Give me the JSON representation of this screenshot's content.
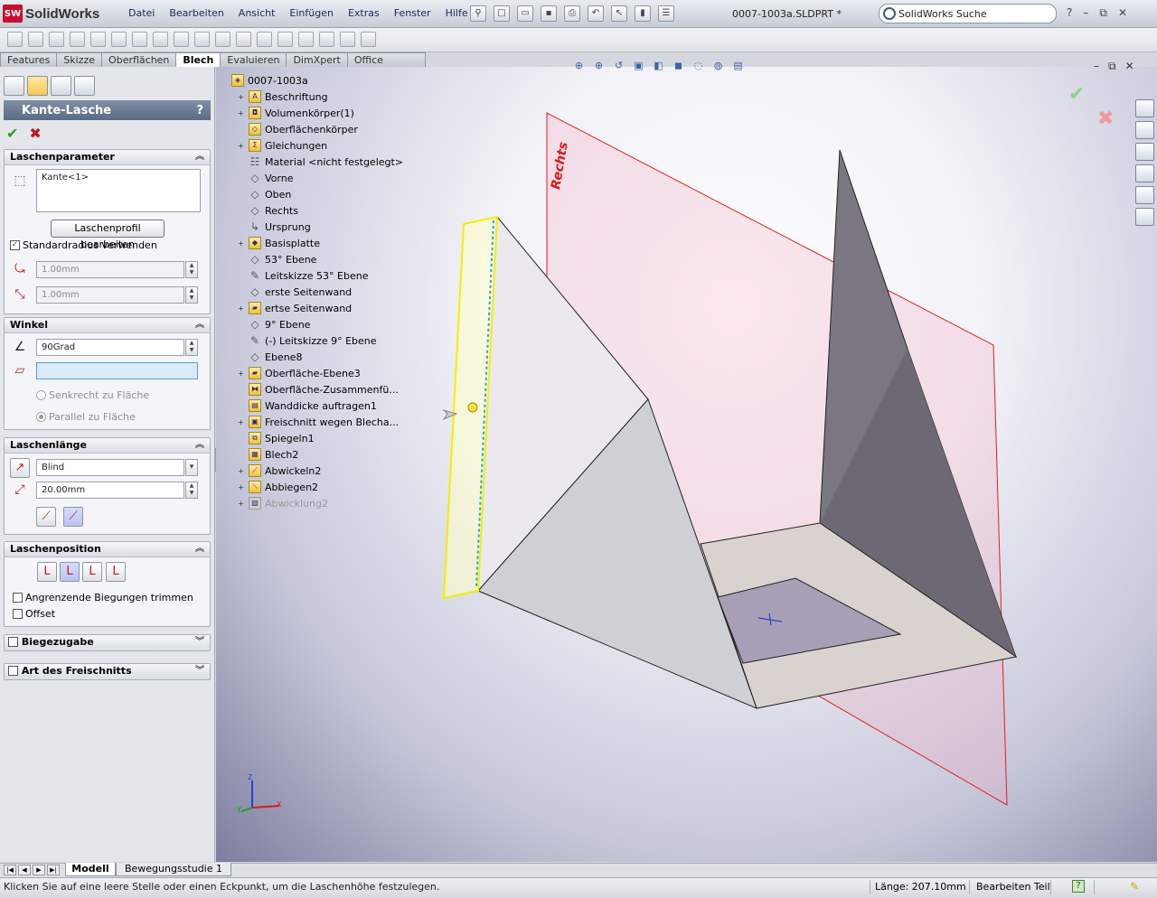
{
  "app": {
    "logo_badge": "SW",
    "logo_text": "SolidWorks",
    "document_title": "0007-1003a.SLDPRT *"
  },
  "menu": [
    "Datei",
    "Bearbeiten",
    "Ansicht",
    "Einfügen",
    "Extras",
    "Fenster",
    "Hilfe"
  ],
  "search": {
    "placeholder": "SolidWorks Suche"
  },
  "window_controls": {
    "help": "?",
    "minimize": "–",
    "restore": "⧉",
    "close": "✕"
  },
  "command_tabs": [
    "Features",
    "Skizze",
    "Oberflächen",
    "Blech",
    "Evaluieren",
    "DimXpert",
    "Office Produkte"
  ],
  "active_tab": "Blech",
  "property_manager": {
    "title": "Kante-Lasche",
    "help": "?",
    "ok": "✔",
    "cancel": "✖",
    "laschenparameter": {
      "header": "Laschenparameter",
      "edge_list": "Kante<1>",
      "edit_profile_button": "Laschenprofil bearbeiten",
      "use_default_radius": "Standardradius verwenden",
      "use_default_radius_checked": true,
      "radius": "1.00mm",
      "gap": "1.00mm"
    },
    "winkel": {
      "header": "Winkel",
      "angle": "90Grad",
      "face_select": "",
      "perpendicular": "Senkrecht zu Fläche",
      "parallel": "Parallel zu Fläche"
    },
    "laschenlaenge": {
      "header": "Laschenlänge",
      "end_condition": "Blind",
      "length": "20.00mm"
    },
    "laschenposition": {
      "header": "Laschenposition",
      "trim_bends": "Angrenzende Biegungen trimmen",
      "offset": "Offset"
    },
    "biegezugabe": {
      "header": "Biegezugabe"
    },
    "freischnitt": {
      "header": "Art des Freischnitts"
    }
  },
  "feature_tree": [
    {
      "label": "0007-1003a",
      "icon": "part-icon",
      "expand": ""
    },
    {
      "label": "Beschriftung",
      "icon": "annotation-icon",
      "expand": "+"
    },
    {
      "label": "Volumenkörper(1)",
      "icon": "solid-bodies-icon",
      "expand": "+"
    },
    {
      "label": "Oberflächenkörper",
      "icon": "surface-bodies-icon",
      "expand": ""
    },
    {
      "label": "Gleichungen",
      "icon": "equations-icon",
      "expand": "+"
    },
    {
      "label": "Material <nicht festgelegt>",
      "icon": "material-icon",
      "expand": ""
    },
    {
      "label": "Vorne",
      "icon": "plane-icon",
      "expand": ""
    },
    {
      "label": "Oben",
      "icon": "plane-icon",
      "expand": ""
    },
    {
      "label": "Rechts",
      "icon": "plane-icon",
      "expand": ""
    },
    {
      "label": "Ursprung",
      "icon": "origin-icon",
      "expand": ""
    },
    {
      "label": "Basisplatte",
      "icon": "base-flange-icon",
      "expand": "+"
    },
    {
      "label": "53° Ebene",
      "icon": "plane-icon",
      "expand": ""
    },
    {
      "label": "Leitskizze 53° Ebene",
      "icon": "sketch-icon",
      "expand": ""
    },
    {
      "label": "erste Seitenwand",
      "icon": "plane-icon",
      "expand": ""
    },
    {
      "label": "ertse Seitenwand",
      "icon": "surface-icon",
      "expand": "+"
    },
    {
      "label": "9° Ebene",
      "icon": "plane-icon",
      "expand": ""
    },
    {
      "label": "(-) Leitskizze 9° Ebene",
      "icon": "sketch-icon",
      "expand": ""
    },
    {
      "label": "Ebene8",
      "icon": "plane-icon",
      "expand": ""
    },
    {
      "label": "Oberfläche-Ebene3",
      "icon": "surface-icon",
      "expand": "+"
    },
    {
      "label": "Oberfläche-Zusammenfü...",
      "icon": "knit-icon",
      "expand": ""
    },
    {
      "label": "Wanddicke auftragen1",
      "icon": "thicken-icon",
      "expand": ""
    },
    {
      "label": "Freischnitt wegen Blecha...",
      "icon": "cut-icon",
      "expand": "+"
    },
    {
      "label": "Spiegeln1",
      "icon": "mirror-icon",
      "expand": ""
    },
    {
      "label": "Blech2",
      "icon": "sheetmetal-icon",
      "expand": ""
    },
    {
      "label": "Abwickeln2",
      "icon": "unfold-icon",
      "expand": "+"
    },
    {
      "label": "Abbiegen2",
      "icon": "fold-icon",
      "expand": "+"
    },
    {
      "label": "Abwicklung2",
      "icon": "flat-pattern-icon",
      "expand": "+",
      "suppressed": true
    }
  ],
  "viewport": {
    "plane_label": "Rechts",
    "axis_z": "Z",
    "axis_x": "X",
    "axis_y": "Y"
  },
  "bottom_tabs": [
    "Modell",
    "Bewegungsstudie 1"
  ],
  "status": {
    "message": "Klicken Sie auf eine leere Stelle oder einen Eckpunkt, um die Laschenhöhe festzulegen.",
    "length": "Länge: 207.10mm",
    "mode": "Bearbeiten Teil",
    "help": "?"
  },
  "colors": {
    "selection_yellow": "#f0f000",
    "plane_red": "#e02020",
    "ok_green": "#2a9b2a",
    "cancel_red": "#c0171c"
  }
}
